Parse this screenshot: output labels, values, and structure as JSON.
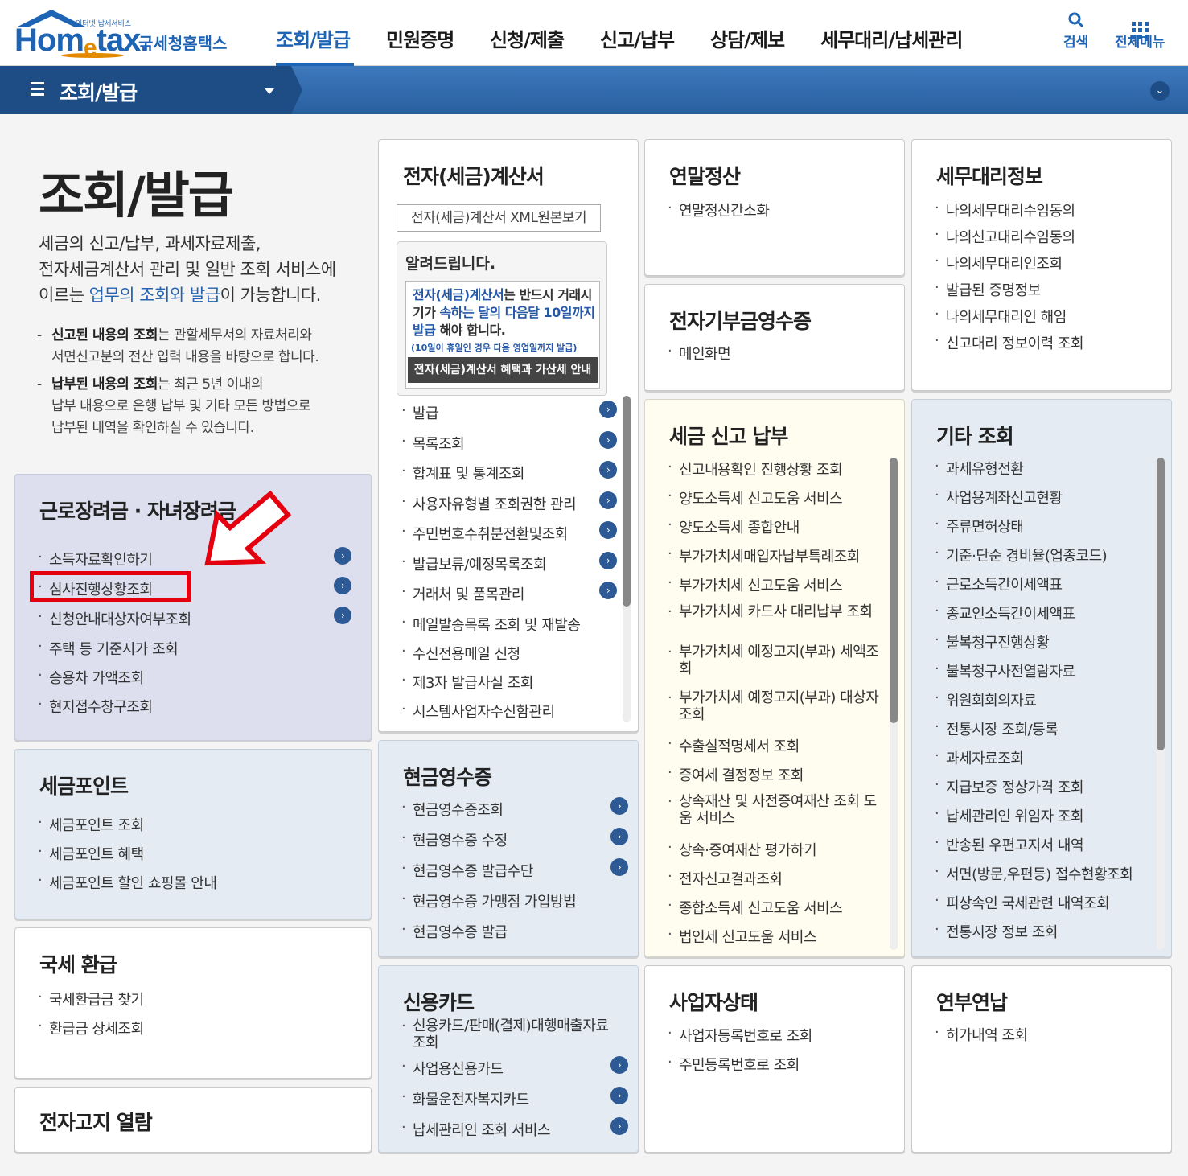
{
  "header": {
    "logo_small": "인터넷 납세서비스",
    "logo_word_a": "Hom",
    "logo_word_e": "e",
    "logo_word_b": "tax.",
    "logo_sub": "국세청홈택스",
    "nav": [
      "조회/발급",
      "민원증명",
      "신청/제출",
      "신고/납부",
      "상담/제보",
      "세무대리/납세관리"
    ],
    "search_label": "검색",
    "menu_label": "전체메뉴"
  },
  "subbar": {
    "title": "조회/발급"
  },
  "intro": {
    "title": "조회/발급",
    "line1": "세금의 신고/납부, 과세자료제출,",
    "line2": "전자세금계산서 관리 및 일반 조회 서비스에",
    "line3_a": "이르는 ",
    "line3_hl": "업무의 조회와 발급",
    "line3_b": "이 가능합니다.",
    "note1_bold": "신고된 내용의 조회",
    "note1_a": "는 관할세무서의 자료처리와",
    "note1_b": "서면신고분의 전산 입력 내용을 바탕으로 합니다.",
    "note2_bold": "납부된 내용의 조회",
    "note2_a": "는 최근 5년 이내의",
    "note2_b": "납부 내용으로 은행 납부 및 기타 모든 방법으로",
    "note2_c": "납부된 내역을 확인하실 수 있습니다."
  },
  "cards": {
    "incentive": {
      "title": "근로장려금 · 자녀장려금",
      "items": [
        "소득자료확인하기",
        "심사진행상황조회",
        "신청안내대상자여부조회",
        "주택 등 기준시가 조회",
        "승용차 가액조회",
        "현지접수창구조회"
      ]
    },
    "taxpoint": {
      "title": "세금포인트",
      "items": [
        "세금포인트 조회",
        "세금포인트 혜택",
        "세금포인트 할인 쇼핑몰 안내"
      ]
    },
    "refund": {
      "title": "국세 환급",
      "items": [
        "국세환급금 찾기",
        "환급금 상세조회"
      ]
    },
    "enotice": {
      "title": "전자고지 열람"
    },
    "einvoice": {
      "title": "전자(세금)계산서",
      "xml_button": "전자(세금)계산서 XML원본보기",
      "notice_title": "알려드립니다.",
      "notice_b1": "전자(세금)계산서",
      "notice_t1": "는 반드시 거래시기가 ",
      "notice_b2": "속하는 달의 다음달 10일까지 발급",
      "notice_t2": " 해야 합니다.",
      "notice_small": "(10일이 휴일인 경우 다음 영업일까지 발급)",
      "notice_bar": "전자(세금)계산서 혜택과 가산세 안내",
      "items": [
        "발급",
        "목록조회",
        "합계표 및 통계조회",
        "사용자유형별 조회권한 관리",
        "주민번호수취분전환및조회",
        "발급보류/예정목록조회",
        "거래처 및 품목관리",
        "메일발송목록 조회 및 재발송",
        "수신전용메일 신청",
        "제3자 발급사실 조회",
        "시스템사업자수신함관리"
      ]
    },
    "cash": {
      "title": "현금영수증",
      "items": [
        "현금영수증조회",
        "현금영수증 수정",
        "현금영수증 발급수단",
        "현금영수증 가맹점 가입방법",
        "현금영수증 발급"
      ]
    },
    "credit": {
      "title": "신용카드",
      "items": [
        "신용카드/판매(결제)대행매출자료조회",
        "사업용신용카드",
        "화물운전자복지카드",
        "납세관리인 조회 서비스"
      ]
    },
    "yearend": {
      "title": "연말정산",
      "items": [
        "연말정산간소화"
      ]
    },
    "donation": {
      "title": "전자기부금영수증",
      "items": [
        "메인화면"
      ]
    },
    "taxreport": {
      "title": "세금 신고 납부",
      "items": [
        "신고내용확인 진행상황 조회",
        "양도소득세 신고도움 서비스",
        "양도소득세 종합안내",
        "부가가치세매입자납부특례조회",
        "부가가치세 신고도움 서비스",
        "부가가치세 카드사 대리납부 조회",
        "부가가치세 예정고지(부과) 세액조회",
        "부가가치세 예정고지(부과) 대상자 조회",
        "수출실적명세서 조회",
        "증여세 결정정보 조회",
        "상속재산 및 사전증여재산 조회 도움 서비스",
        "상속·증여재산 평가하기",
        "전자신고결과조회",
        "종합소득세 신고도움 서비스",
        "법인세 신고도움 서비스"
      ]
    },
    "bizstatus": {
      "title": "사업자상태",
      "items": [
        "사업자등록번호로 조회",
        "주민등록번호로 조회"
      ]
    },
    "agent": {
      "title": "세무대리정보",
      "items": [
        "나의세무대리수임동의",
        "나의신고대리수임동의",
        "나의세무대리인조회",
        "발급된 증명정보",
        "나의세무대리인 해임",
        "신고대리 정보이력 조회"
      ]
    },
    "etc": {
      "title": "기타 조회",
      "items": [
        "과세유형전환",
        "사업용계좌신고현황",
        "주류면허상태",
        "기준·단순 경비율(업종코드)",
        "근로소득간이세액표",
        "종교인소득간이세액표",
        "불복청구진행상황",
        "불복청구사전열람자료",
        "위원회회의자료",
        "전통시장 조회/등록",
        "과세자료조회",
        "지급보증 정상가격 조회",
        "납세관리인 위임자 조회",
        "반송된 우편고지서 내역",
        "서면(방문,우편등) 접수현황조회",
        "피상속인 국세관련 내역조회",
        "전통시장 정보 조회"
      ]
    },
    "installment": {
      "title": "연부연납",
      "items": [
        "허가내역 조회"
      ]
    }
  },
  "colors": {
    "brand": "#1e64b4",
    "highlight": "#e4000f",
    "orange": "#e38a00"
  }
}
